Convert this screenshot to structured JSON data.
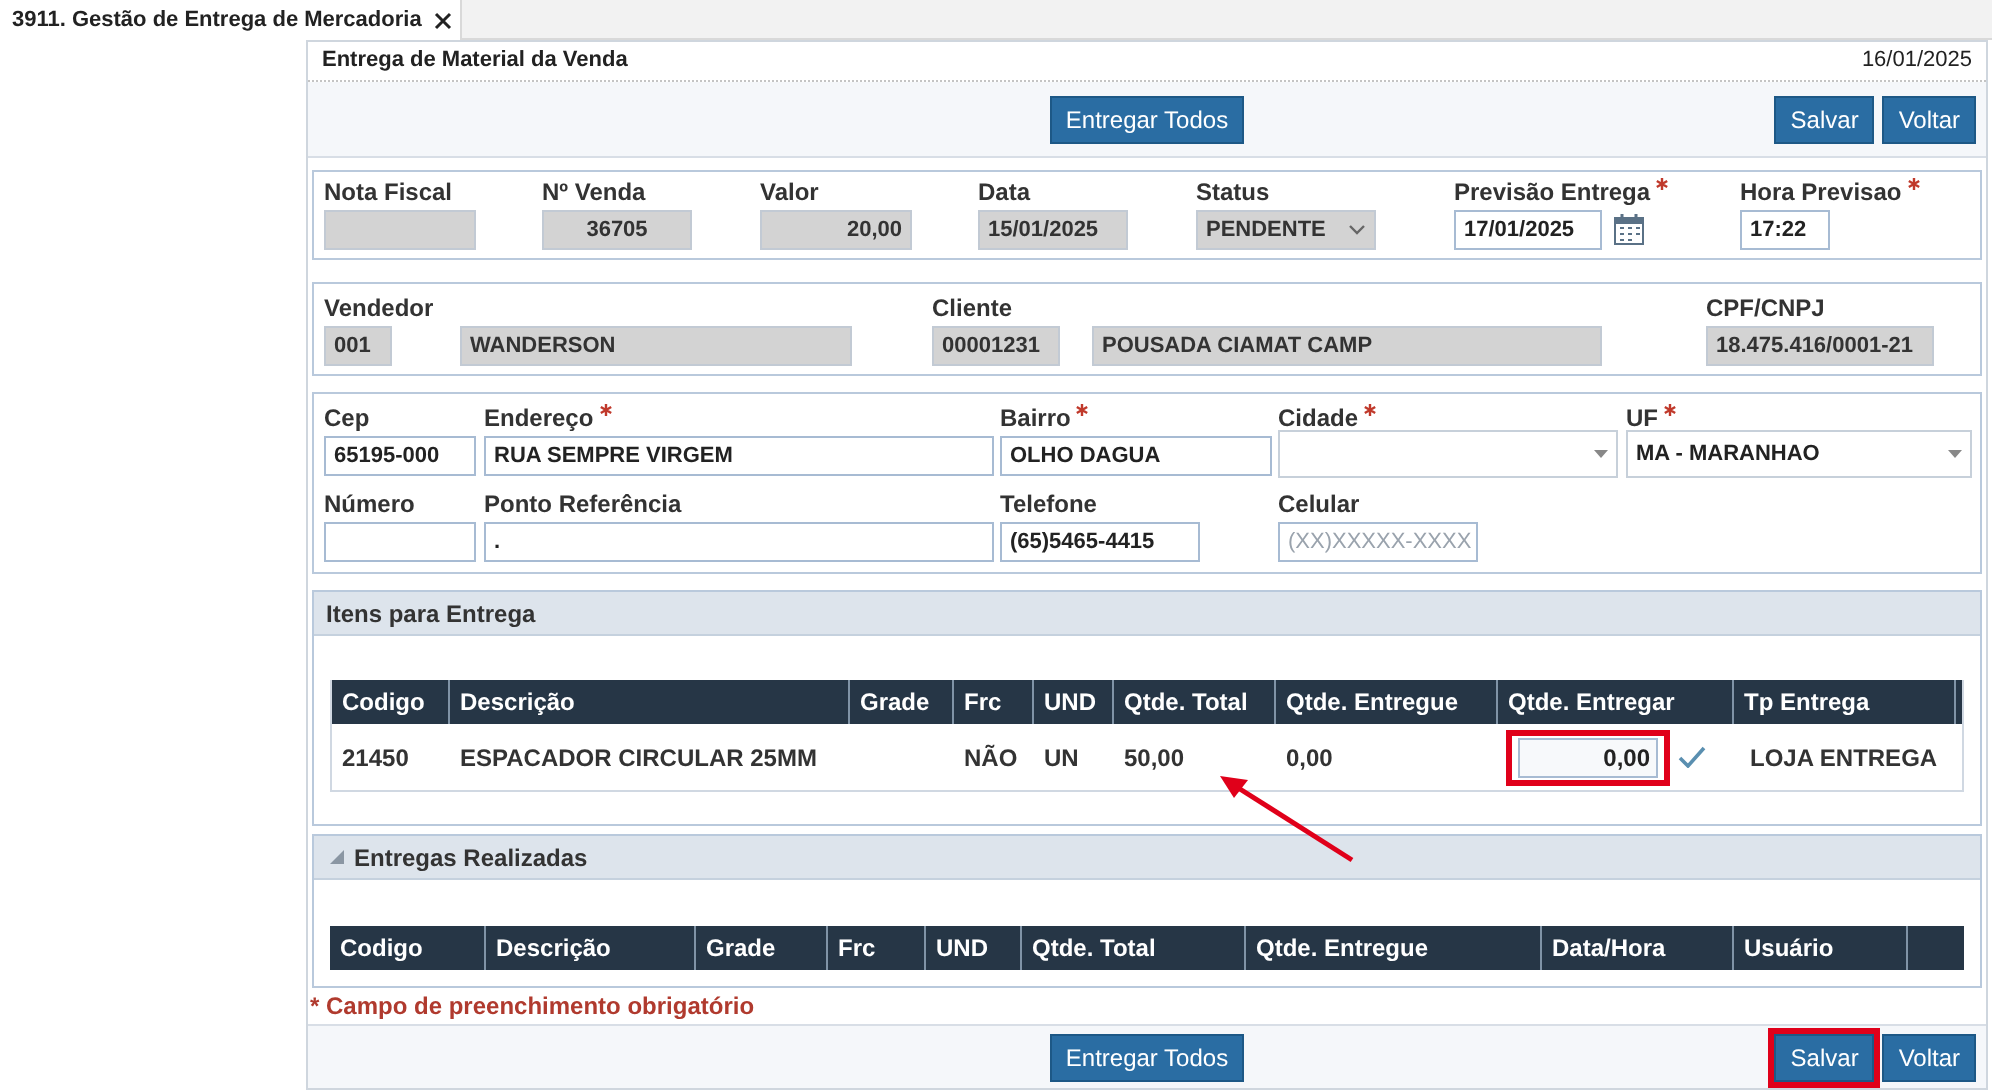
{
  "tab": {
    "label": "3911. Gestão de Entrega de Mercadoria",
    "selected": true
  },
  "header": {
    "title": "Entrega de Material da Venda",
    "date": "16/01/2025"
  },
  "top_actions": [
    {
      "label": "Entregar Todos",
      "highlighted": false
    },
    {
      "label": "Salvar",
      "highlighted": false
    },
    {
      "label": "Voltar",
      "highlighted": false
    }
  ],
  "sale_fields": [
    {
      "label": "Nota Fiscal",
      "kind": "readonly",
      "required": false
    },
    {
      "label": "Nº Venda",
      "kind": "readonly",
      "required": false,
      "value": "36705"
    },
    {
      "label": "Valor",
      "kind": "readonly",
      "required": false,
      "value": "20,00"
    },
    {
      "label": "Data",
      "kind": "readonly",
      "required": false,
      "value": "15/01/2025"
    },
    {
      "label": "Status",
      "kind": "readonly-select",
      "required": false,
      "value": "PENDENTE"
    },
    {
      "label": "Previsão Entrega",
      "kind": "date",
      "required": true,
      "value": "17/01/2025"
    },
    {
      "label": "Hora Previsao",
      "kind": "input",
      "required": true,
      "value": "17:22"
    }
  ],
  "party_fields": [
    {
      "label": "Vendedor",
      "code": "001",
      "name": "WANDERSON"
    },
    {
      "label": "Cliente",
      "code": "00001231",
      "name": "POUSADA CIAMAT CAMP"
    },
    {
      "label": "CPF/CNPJ",
      "code": "18.475.416/0001-21"
    }
  ],
  "address_rows": [
    [
      {
        "label": "Cep",
        "kind": "input",
        "required": false,
        "value": "65195-000"
      },
      {
        "label": "Endereço",
        "kind": "input",
        "required": true,
        "value": "RUA SEMPRE VIRGEM"
      },
      {
        "label": "Bairro",
        "kind": "input",
        "required": true,
        "value": "OLHO DAGUA"
      },
      {
        "label": "Cidade",
        "kind": "select",
        "required": true
      },
      {
        "label": "UF",
        "kind": "select",
        "required": true,
        "value": "MA - MARANHAO"
      }
    ],
    [
      {
        "label": "Número",
        "kind": "input",
        "required": false
      },
      {
        "label": "Ponto Referência",
        "kind": "input",
        "required": false,
        "value": "."
      },
      {
        "label": "Telefone",
        "kind": "input",
        "required": false,
        "value": "(65)5465-4415"
      },
      {
        "label": "Celular",
        "kind": "input",
        "required": false,
        "placeholder": "(XX)XXXXX-XXXX"
      }
    ]
  ],
  "items": {
    "title": "Itens para Entrega",
    "columns": [
      "Codigo",
      "Descrição",
      "Grade",
      "Frc",
      "UND",
      "Qtde. Total",
      "Qtde. Entregue",
      "Qtde. Entregar",
      "Tp Entrega"
    ],
    "rows": [
      {
        "cells": [
          "21450",
          "ESPACADOR CIRCULAR 25MM",
          null,
          "NÃO",
          "UN",
          "50,00",
          "0,00"
        ],
        "to_deliver": "0,00",
        "highlighted": true,
        "delivery_type": "LOJA ENTREGA"
      }
    ]
  },
  "deliveries": {
    "title": "Entregas Realizadas",
    "expanded": true,
    "columns": [
      "Codigo",
      "Descrição",
      "Grade",
      "Frc",
      "UND",
      "Qtde. Total",
      "Qtde. Entregue",
      "Data/Hora",
      "Usuário"
    ]
  },
  "footnote": "* Campo de preenchimento obrigatório",
  "bottom_actions": [
    {
      "label": "Entregar Todos",
      "highlighted": false
    },
    {
      "label": "Salvar",
      "highlighted": true
    },
    {
      "label": "Voltar",
      "highlighted": false
    }
  ]
}
